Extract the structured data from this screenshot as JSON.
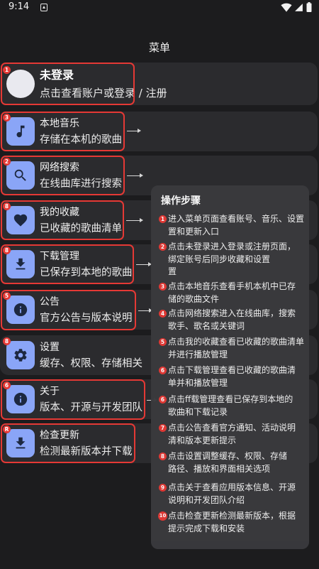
{
  "status_bar": {
    "time": "9:14",
    "icons": [
      "notification-icon",
      "wifi-icon",
      "signal-icon",
      "battery-icon"
    ]
  },
  "header": {
    "title": "菜单"
  },
  "account": {
    "badge": "1",
    "title": "未登录",
    "subtitle": "点击查看账户或登录 / 注册"
  },
  "menu": {
    "items": [
      {
        "badge": "3",
        "title": "本地音乐",
        "subtitle": "存储在本机的歌曲",
        "icon": "music-note-icon"
      },
      {
        "badge": "2",
        "title": "网络搜索",
        "subtitle": "在线曲库进行搜索",
        "icon": "search-icon"
      },
      {
        "badge": "8",
        "title": "我的收藏",
        "subtitle": "已收藏的歌曲清单",
        "icon": "heart-icon"
      },
      {
        "badge": "8",
        "title": "下载管理",
        "subtitle": "已保存到本地的歌曲",
        "icon": "download-icon"
      },
      {
        "badge": "5",
        "title": "公告",
        "subtitle": "官方公告与版本说明",
        "icon": "info-icon"
      },
      {
        "badge": "8",
        "title": "设置",
        "subtitle": "缓存、权限、存储相关",
        "icon": "gear-icon"
      },
      {
        "badge": "6",
        "title": "关于",
        "subtitle": "版本、开源与开发团队",
        "icon": "info-icon"
      },
      {
        "badge": "R",
        "title": "检查更新",
        "subtitle": "检测最新版本并下载",
        "icon": "download-icon"
      }
    ]
  },
  "steps_panel": {
    "title": "操作步骤",
    "steps": [
      {
        "number": "1",
        "lines": [
          "进入菜单页面查看账号、音乐、设置",
          "置和更新入口"
        ]
      },
      {
        "number": "2",
        "lines": [
          "点击未登录进入登录或注册页面，",
          "绑定账号后同步收藏和设置",
          "置"
        ]
      },
      {
        "number": "3",
        "lines": [
          "点击本地音乐查看手机本机中已存",
          "储的歌曲文件"
        ]
      },
      {
        "number": "4",
        "lines": [
          "点击网络搜索进入在线曲库，搜索",
          "歌手、歌名或关键词"
        ]
      },
      {
        "number": "5",
        "lines": [
          "点击我的收藏查看已收藏的歌曲清单",
          "并进行播放管理"
        ]
      },
      {
        "number": "6",
        "lines": [
          "点击下载管理查看已收藏的歌曲清",
          "单并和播放管理"
        ]
      },
      {
        "number": "6",
        "lines": [
          "点击ff载管理查看已保存到本地的",
          "歌曲和下载记录"
        ]
      },
      {
        "number": "7",
        "lines": [
          "点击公告查看官方通知、活动说明",
          "清和版本更新提示"
        ]
      },
      {
        "number": "8",
        "lines": [
          "点击设置调整缓存、权限、存储",
          "路径、播放和界面相关选项"
        ]
      },
      {
        "number": "9",
        "lines": [
          "点击关于查看应用版本信息、开源",
          "说明和开发团队介绍"
        ]
      },
      {
        "number": "10",
        "lines": [
          "点击检查更新检测最新版本，根据",
          "提示完成下载和安装"
        ]
      }
    ]
  },
  "colors": {
    "background": "#1c1c1e",
    "card": "#2b2b2e",
    "icon_tile": "#8aa5f7",
    "icon_glyph": "#1d2840",
    "annotation_red": "#e53935",
    "panel": "#3a3a3d"
  }
}
